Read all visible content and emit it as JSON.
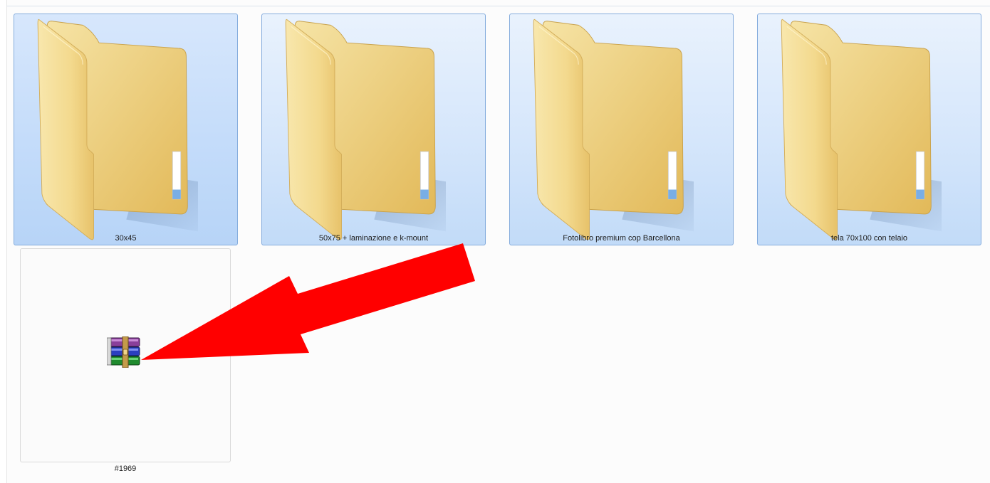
{
  "folders": [
    {
      "name": "30x45"
    },
    {
      "name": "50x75 + laminazione e k-mount"
    },
    {
      "name": "Fotolibro premium cop Barcellona"
    },
    {
      "name": "tela 70x100 con telaio"
    }
  ],
  "file": {
    "name": "#1969",
    "icon": "winrar-archive-icon"
  },
  "annotation": {
    "color": "#ff0000",
    "icon": "red-arrow"
  }
}
